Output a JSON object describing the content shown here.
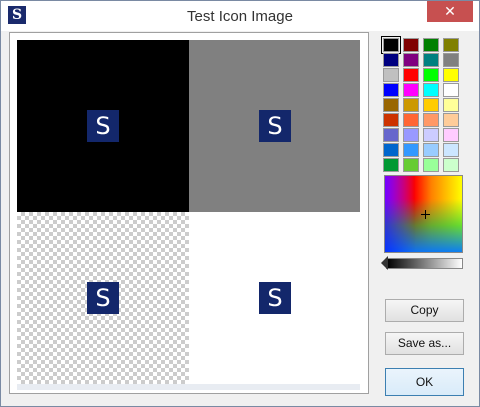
{
  "window": {
    "title": "Test Icon Image",
    "app_icon_letter": "S",
    "close_glyph": "✕"
  },
  "canvas": {
    "icon_letter": "S",
    "backgrounds": [
      "black",
      "gray",
      "transparent-checkerboard",
      "white"
    ]
  },
  "palette": {
    "swatches": [
      "#000000",
      "#800000",
      "#008000",
      "#808000",
      "#000080",
      "#800080",
      "#008080",
      "#808080",
      "#c0c0c0",
      "#ff0000",
      "#00ff00",
      "#ffff00",
      "#0000ff",
      "#ff00ff",
      "#00ffff",
      "#ffffff",
      "#996600",
      "#cc9900",
      "#ffcc00",
      "#ffff99",
      "#cc3300",
      "#ff6633",
      "#ff9966",
      "#ffcc99",
      "#6666cc",
      "#9999ff",
      "#ccccff",
      "#ffccff",
      "#0066cc",
      "#3399ff",
      "#99ccff",
      "#cce6ff",
      "#009933",
      "#66cc33",
      "#99ff99",
      "#ccffcc"
    ],
    "selected_index": 0
  },
  "buttons": {
    "copy": "Copy",
    "save_as": "Save as...",
    "ok": "OK"
  },
  "colors": {
    "icon_bg": "#13276b",
    "close_button": "#c75050",
    "primary_border": "#3c7fb1"
  }
}
